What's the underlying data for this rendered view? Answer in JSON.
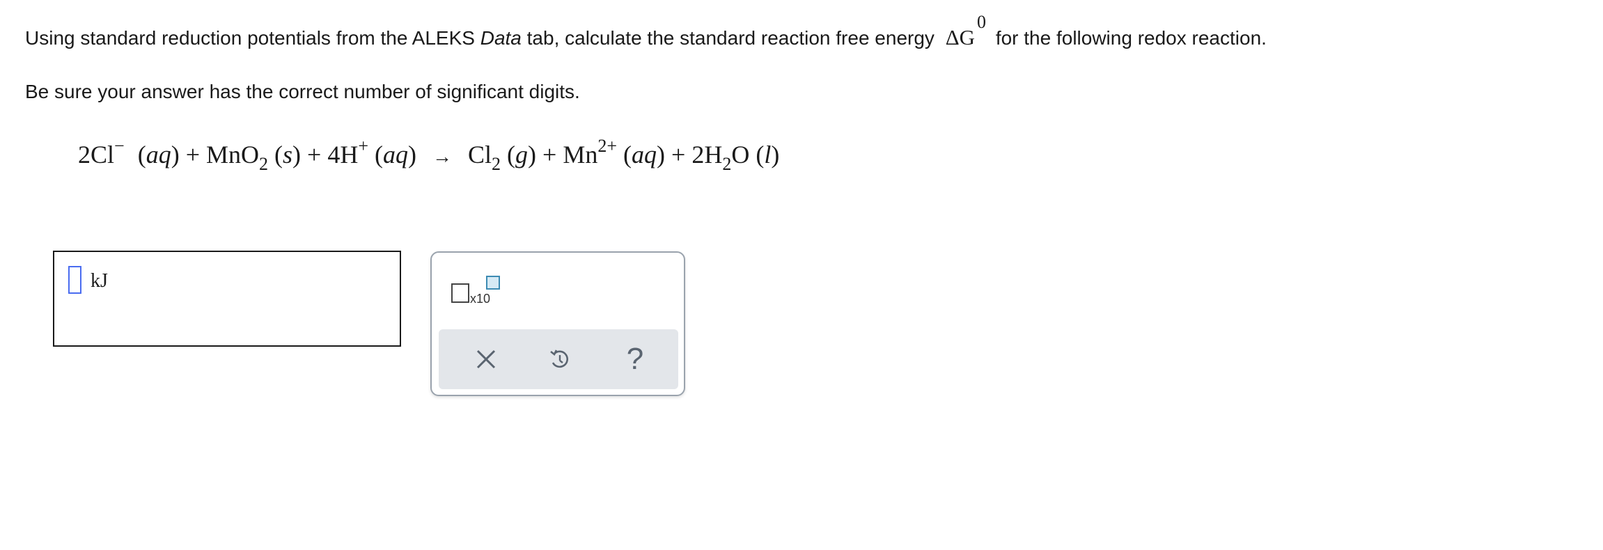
{
  "question": {
    "line1_before": "Using standard reduction potentials from the ALEKS",
    "data_word": "Data",
    "line1_mid": "tab, calculate the standard reaction free energy",
    "delta_g_symbol": "ΔG",
    "delta_g_superscript": "0",
    "line1_after": "for the following redox reaction.",
    "line2": "Be sure your answer has the correct number of significant digits."
  },
  "equation": {
    "cl_coef": "2Cl",
    "cl_charge": "−",
    "aq1": "aq",
    "plus1": "+",
    "mno2": "MnO",
    "mno2_sub": "2",
    "s": "s",
    "plus2": "+",
    "h_coef": "4H",
    "h_charge": "+",
    "aq2": "aq",
    "arrow": "→",
    "cl2": "Cl",
    "cl2_sub": "2",
    "g": "g",
    "plus3": "+",
    "mn": "Mn",
    "mn_charge": "2+",
    "aq3": "aq",
    "plus4": "+",
    "h2o_pre": "2H",
    "h2o_sub": "2",
    "h2o_post": "O",
    "l": "l"
  },
  "answer": {
    "value": "",
    "unit": "kJ"
  },
  "palette": {
    "x10_label": "x10",
    "clear_icon": "close-icon",
    "undo_icon": "undo-icon",
    "help_label": "?"
  },
  "colors": {
    "cursor": "#4a6cf0",
    "palette_border": "#9aa3ad",
    "palette_bar": "#e3e6ea",
    "x10_accent": "#3d8bb3"
  }
}
